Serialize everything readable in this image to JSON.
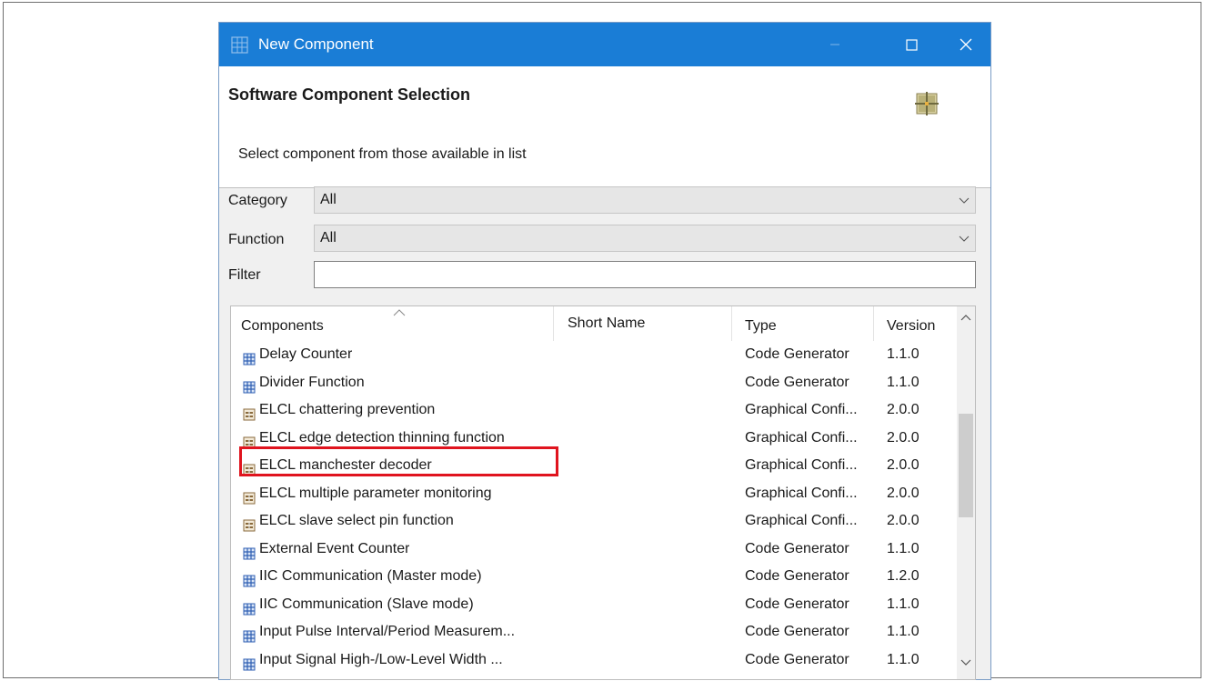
{
  "window": {
    "title": "New Component",
    "controls": {
      "minimize": "minimize",
      "maximize": "maximize",
      "close": "close"
    }
  },
  "header": {
    "title": "Software Component Selection",
    "subtitle": "Select component from those available in list",
    "icon": "component-grid-icon"
  },
  "form": {
    "category": {
      "label": "Category",
      "value": "All"
    },
    "function": {
      "label": "Function",
      "value": "All"
    },
    "filter": {
      "label": "Filter",
      "value": "",
      "placeholder": ""
    }
  },
  "table": {
    "columns": {
      "components": "Components",
      "short_name": "Short Name",
      "type": "Type",
      "version": "Version"
    },
    "rows": [
      {
        "icon": "code-generator-icon",
        "name": "Delay Counter",
        "short_name": "",
        "type": "Code Generator",
        "version": "1.1.0"
      },
      {
        "icon": "code-generator-icon",
        "name": "Divider Function",
        "short_name": "",
        "type": "Code Generator",
        "version": "1.1.0"
      },
      {
        "icon": "graphical-config-icon",
        "name": "ELCL chattering prevention",
        "short_name": "",
        "type": "Graphical Confi...",
        "version": "2.0.0"
      },
      {
        "icon": "graphical-config-icon",
        "name": "ELCL edge detection thinning function",
        "short_name": "",
        "type": "Graphical Confi...",
        "version": "2.0.0"
      },
      {
        "icon": "graphical-config-icon",
        "name": "ELCL manchester decoder",
        "short_name": "",
        "type": "Graphical Confi...",
        "version": "2.0.0"
      },
      {
        "icon": "graphical-config-icon",
        "name": "ELCL multiple parameter monitoring",
        "short_name": "",
        "type": "Graphical Confi...",
        "version": "2.0.0"
      },
      {
        "icon": "graphical-config-icon",
        "name": "ELCL slave select pin function",
        "short_name": "",
        "type": "Graphical Confi...",
        "version": "2.0.0"
      },
      {
        "icon": "code-generator-icon",
        "name": "External Event Counter",
        "short_name": "",
        "type": "Code Generator",
        "version": "1.1.0"
      },
      {
        "icon": "code-generator-icon",
        "name": "IIC Communication (Master mode)",
        "short_name": "",
        "type": "Code Generator",
        "version": "1.2.0"
      },
      {
        "icon": "code-generator-icon",
        "name": "IIC Communication (Slave mode)",
        "short_name": "",
        "type": "Code Generator",
        "version": "1.1.0"
      },
      {
        "icon": "code-generator-icon",
        "name": "Input Pulse Interval/Period Measurem...",
        "short_name": "",
        "type": "Code Generator",
        "version": "1.1.0"
      },
      {
        "icon": "code-generator-icon",
        "name": "Input Signal High-/Low-Level Width ...",
        "short_name": "",
        "type": "Code Generator",
        "version": "1.1.0"
      }
    ]
  },
  "colors": {
    "titlebar": "#1a7dd6",
    "highlight": "#e0141e",
    "code_generator_icon": "#2f5fb3",
    "graphical_config_icon": "#8a6a3c"
  }
}
